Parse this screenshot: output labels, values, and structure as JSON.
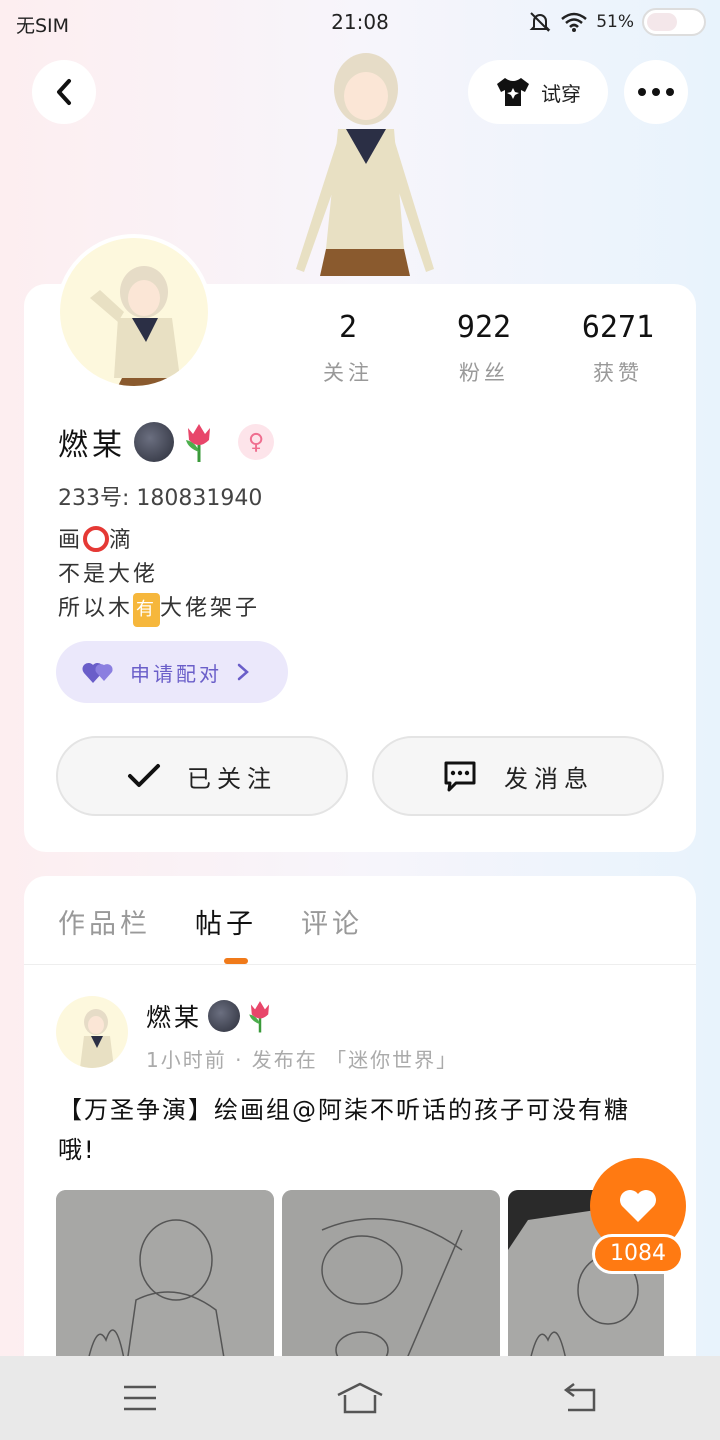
{
  "status_bar": {
    "carrier": "无SIM",
    "time": "21:08",
    "battery": "51%"
  },
  "header": {
    "back_icon": "chevron-left-icon",
    "tryon_label": "试穿",
    "more_icon": "more-dots-icon"
  },
  "profile": {
    "username": "燃某",
    "uid": "233号: 180831940",
    "gender": "female",
    "stats": [
      {
        "value": "2",
        "label": "关注"
      },
      {
        "value": "922",
        "label": "粉丝"
      },
      {
        "value": "6271",
        "label": "获赞"
      }
    ],
    "bio_line1_a": "画",
    "bio_line1_b": "滴",
    "bio_line2": "不是大佬",
    "bio_line3_a": "所以木",
    "bio_line3_badge": "有",
    "bio_line3_b": "大佬架子",
    "pair_label": "申请配对",
    "follow_label": "已关注",
    "message_label": "发消息"
  },
  "tabs": [
    {
      "label": "作品栏",
      "active": false
    },
    {
      "label": "帖子",
      "active": true
    },
    {
      "label": "评论",
      "active": false
    }
  ],
  "post": {
    "author": "燃某",
    "meta": "1小时前 · 发布在 「迷你世界」",
    "text": "【万圣争演】绘画组@阿柒不听话的孩子可没有糖哦!",
    "like_count": "1084"
  },
  "colors": {
    "accent": "#ff7a12",
    "pair_bg": "#ebe8fb",
    "pair_text": "#6a5ec9"
  }
}
